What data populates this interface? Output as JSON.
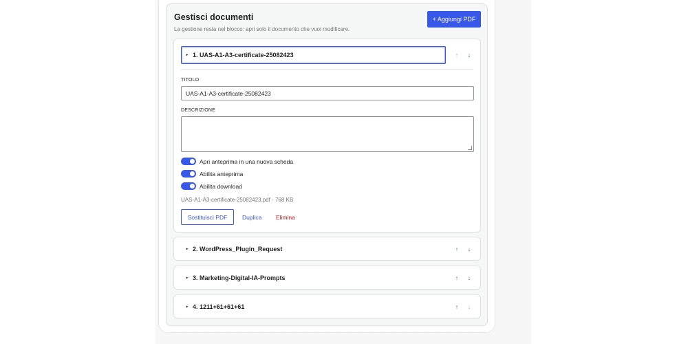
{
  "panel": {
    "title": "Gestisci documenti",
    "description": "La gestione resta nel blocco: apri solo il documento che vuoi modificare.",
    "add_label": "+ Aggiungi PDF"
  },
  "documents": [
    {
      "heading": "1. UAS-A1-A3-certificate-25082423",
      "expanded": true,
      "title_label": "TITOLO",
      "title_value": "UAS-A1-A3-certificate-25082423",
      "description_label": "DESCRIZIONE",
      "description_value": "",
      "toggles": [
        {
          "label": "Apri anteprima in una nuova scheda",
          "on": true
        },
        {
          "label": "Abilita anteprima",
          "on": true
        },
        {
          "label": "Abilita download",
          "on": true
        }
      ],
      "file_info": "UAS-A1-A3-certificate-25082423.pdf · 768 KB",
      "replace_label": "Sostituisci PDF",
      "duplicate_label": "Duplica",
      "delete_label": "Elimina"
    },
    {
      "heading": "2. WordPress_Plugin_Request",
      "expanded": false
    },
    {
      "heading": "3. Marketing-Digital-IA-Prompts",
      "expanded": false
    },
    {
      "heading": "4. 1211+61+61+61",
      "expanded": false
    }
  ],
  "arrows": {
    "up": "↑",
    "down": "↓"
  },
  "caret": "▸",
  "colors": {
    "accent": "#3858e9",
    "danger": "#cc1818",
    "muted": "#757575",
    "disabled": "#a7aaad"
  }
}
